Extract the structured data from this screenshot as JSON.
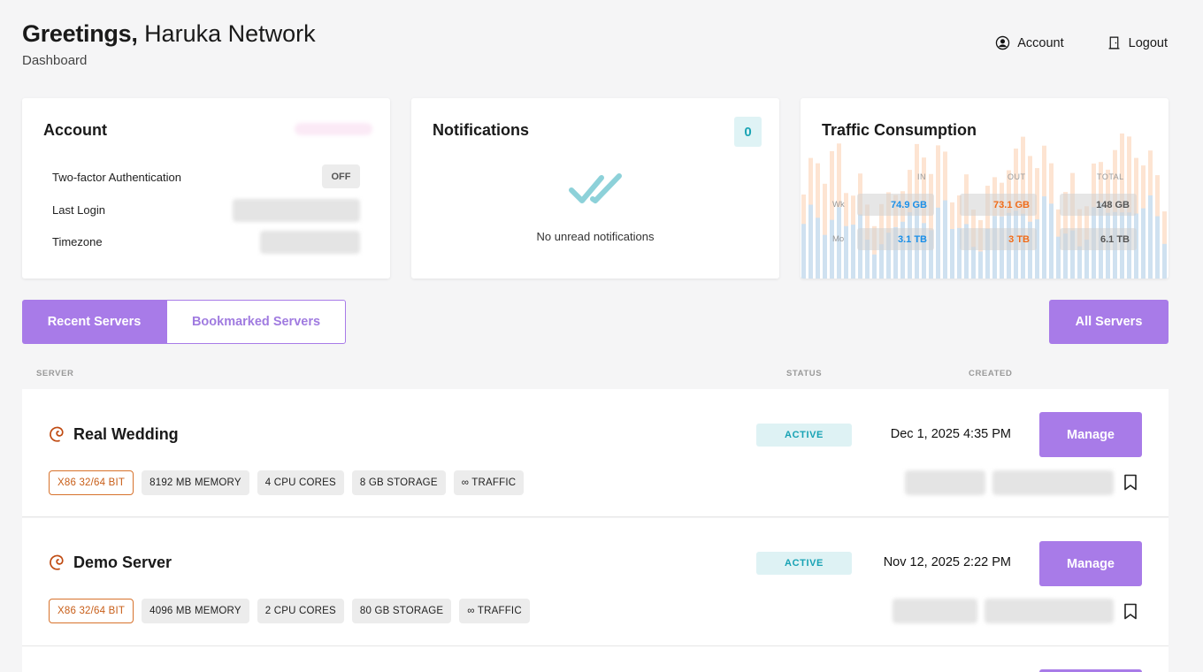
{
  "header": {
    "greeting": "Greetings,",
    "name": "Haruka Network",
    "subtitle": "Dashboard"
  },
  "topnav": {
    "account_label": "Account",
    "logout_label": "Logout"
  },
  "account_card": {
    "title": "Account",
    "rows": [
      {
        "label": "Two-factor Authentication",
        "value": "OFF"
      },
      {
        "label": "Last Login",
        "value": ""
      },
      {
        "label": "Timezone",
        "value": ""
      }
    ]
  },
  "notifications": {
    "title": "Notifications",
    "count": "0",
    "empty_text": "No unread notifications"
  },
  "traffic": {
    "title": "Traffic Consumption",
    "columns": [
      "IN",
      "OUT",
      "TOTAL"
    ],
    "rows": [
      {
        "label": "Wk",
        "in": "74.9 GB",
        "out": "73.1 GB",
        "total": "148 GB"
      },
      {
        "label": "Mo",
        "in": "3.1 TB",
        "out": "3 TB",
        "total": "6.1 TB"
      }
    ],
    "colors": {
      "in": "#1a8fe8",
      "out": "#f06b18",
      "bar_in": "#cfe1f0",
      "bar_out": "#fde4d2"
    }
  },
  "tabs": {
    "recent": "Recent Servers",
    "bookmarked": "Bookmarked Servers"
  },
  "all_servers_label": "All Servers",
  "table": {
    "col_server": "SERVER",
    "col_status": "STATUS",
    "col_created": "CREATED"
  },
  "servers": [
    {
      "name": "Real Wedding",
      "status": "ACTIVE",
      "created": "Dec 1, 2025 4:35 PM",
      "manage_label": "Manage",
      "specs": [
        "X86 32/64 BIT",
        "8192 MB MEMORY",
        "4 CPU CORES",
        "8 GB STORAGE",
        "∞ TRAFFIC"
      ],
      "os_icon": "debian-icon"
    },
    {
      "name": "Demo Server",
      "status": "ACTIVE",
      "created": "Nov 12, 2025 2:22 PM",
      "manage_label": "Manage",
      "specs": [
        "X86 32/64 BIT",
        "4096 MB MEMORY",
        "2 CPU CORES",
        "80 GB STORAGE",
        "∞ TRAFFIC"
      ],
      "os_icon": "debian-icon"
    }
  ],
  "accent_color": "#a87be8"
}
